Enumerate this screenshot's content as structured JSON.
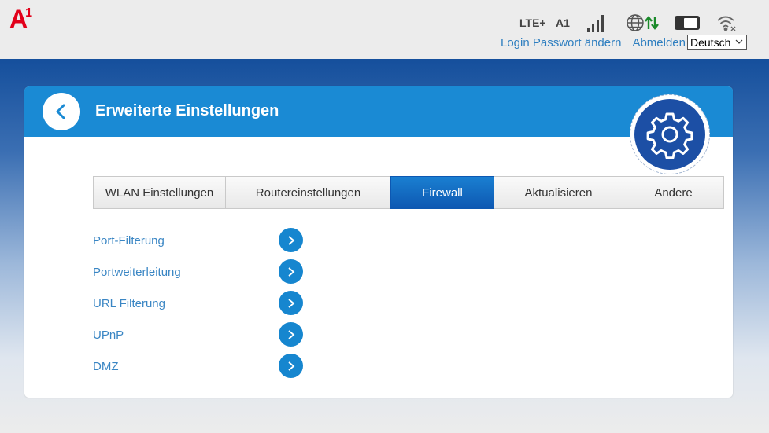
{
  "header": {
    "logo_letter": "A",
    "logo_sup": "1",
    "network_type": "LTE+",
    "operator": "A1",
    "signal_icon": "signal-bars-icon",
    "globe_icon": "globe-icon",
    "data_arrows_icon": "up-down-arrows-icon",
    "battery_icon": "battery-icon",
    "wifi_icon": "wifi-off-icon",
    "login_password_link": "Login Passwort ändern",
    "logout_link": "Abmelden",
    "language_selected": "Deutsch"
  },
  "card": {
    "title": "Erweiterte Einstellungen",
    "back_icon": "chevron-left-icon",
    "settings_icon": "gear-icon"
  },
  "tabs": [
    {
      "label": "WLAN Einstellungen",
      "active": false
    },
    {
      "label": "Routereinstellungen",
      "active": false
    },
    {
      "label": "Firewall",
      "active": true
    },
    {
      "label": "Aktualisieren",
      "active": false
    },
    {
      "label": "Andere",
      "active": false
    }
  ],
  "firewall_items": [
    {
      "label": "Port-Filterung"
    },
    {
      "label": "Portweiterleitung"
    },
    {
      "label": "URL Filterung"
    },
    {
      "label": "UPnP"
    },
    {
      "label": "DMZ"
    }
  ],
  "colors": {
    "brand_red": "#e2001a",
    "header_blue": "#1a8ad4",
    "tab_active": "#0d58b2",
    "link_blue": "#3a86c4",
    "gear_blue": "#1c4fa5"
  }
}
